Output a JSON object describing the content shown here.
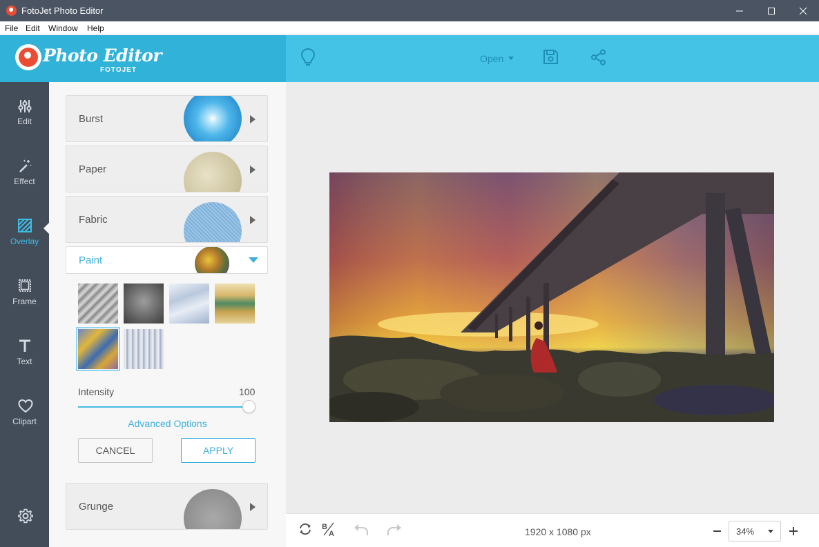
{
  "window": {
    "title": "FotoJet Photo Editor",
    "menu": [
      "File",
      "Edit",
      "Window",
      "Help"
    ]
  },
  "header": {
    "logo_text": "Photo Editor",
    "logo_sub": "FOTOJET",
    "open_label": "Open",
    "icons": [
      "lightbulb-icon",
      "save-icon",
      "share-icon"
    ]
  },
  "rail": {
    "items": [
      {
        "label": "Edit",
        "icon": "sliders-icon"
      },
      {
        "label": "Effect",
        "icon": "magic-wand-icon"
      },
      {
        "label": "Overlay",
        "icon": "overlay-icon",
        "active": true
      },
      {
        "label": "Frame",
        "icon": "frame-icon"
      },
      {
        "label": "Text",
        "icon": "text-icon"
      },
      {
        "label": "Clipart",
        "icon": "heart-icon"
      }
    ],
    "settings_icon": "gear-icon"
  },
  "panel": {
    "categories": [
      {
        "label": "Burst"
      },
      {
        "label": "Paper"
      },
      {
        "label": "Fabric"
      },
      {
        "label": "Paint",
        "expanded": true
      },
      {
        "label": "Grunge"
      }
    ],
    "textures_count": 6,
    "selected_texture": 5,
    "intensity_label": "Intensity",
    "intensity_value": "100",
    "advanced_label": "Advanced Options",
    "cancel_label": "CANCEL",
    "apply_label": "APPLY"
  },
  "bottombar": {
    "dimensions": "1920 x 1080 px",
    "zoom": "34%",
    "icons": [
      "rotate-icon",
      "compare-icon",
      "undo-icon",
      "redo-icon",
      "zoom-out-icon",
      "zoom-in-icon"
    ]
  },
  "colors": {
    "accent": "#3fb0dc",
    "header": "#44c3e6",
    "logo_area": "#31b2d9",
    "rail": "#434d5a",
    "titlebar": "#4a5463"
  }
}
